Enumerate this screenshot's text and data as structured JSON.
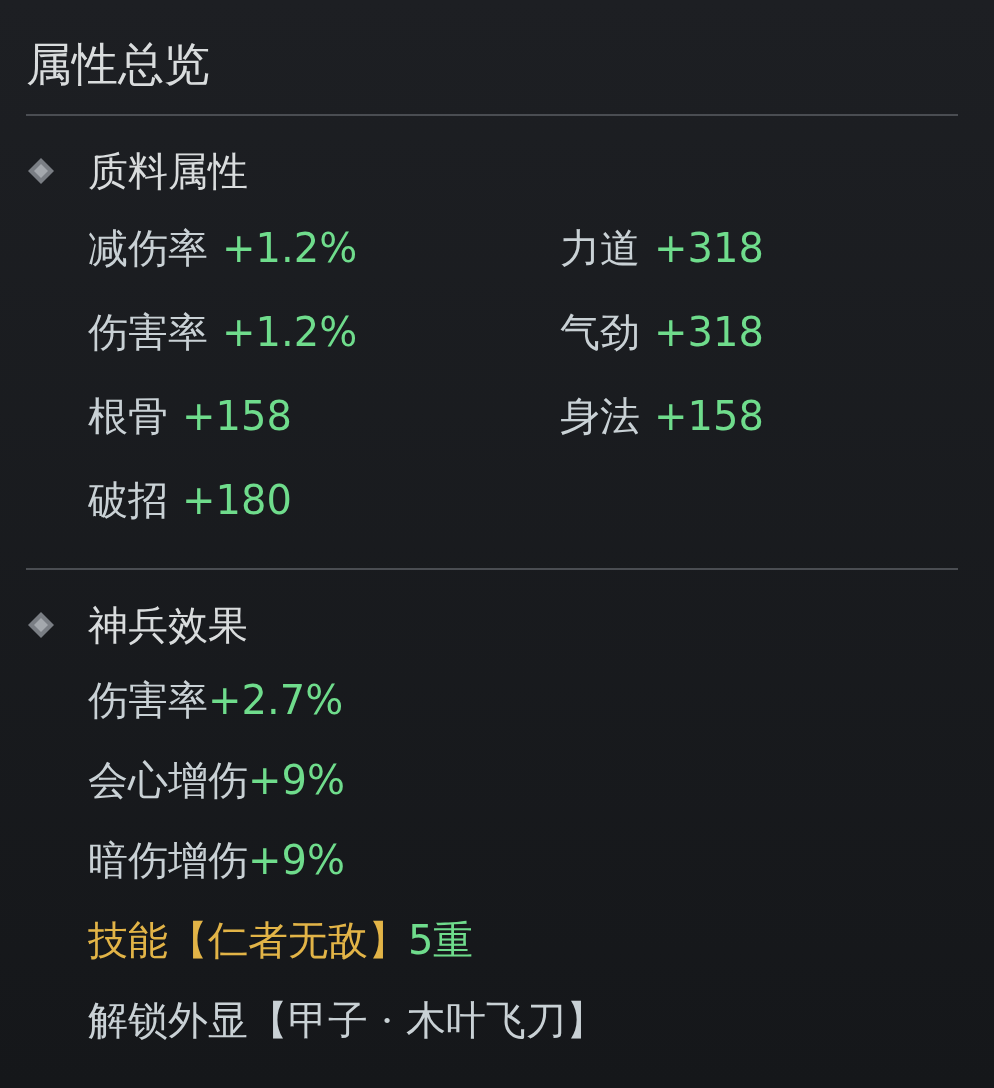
{
  "title": "属性总览",
  "sections": [
    {
      "kind": "grid",
      "header": "质料属性",
      "items": [
        {
          "kind": "stat",
          "label": "减伤率",
          "value": "+1.2%"
        },
        {
          "kind": "stat",
          "label": "力道",
          "value": "+318"
        },
        {
          "kind": "stat",
          "label": "伤害率",
          "value": "+1.2%"
        },
        {
          "kind": "stat",
          "label": "气劲",
          "value": "+318"
        },
        {
          "kind": "stat",
          "label": "根骨",
          "value": "+158"
        },
        {
          "kind": "stat",
          "label": "身法",
          "value": "+158"
        },
        {
          "kind": "stat",
          "label": "破招",
          "value": "+180"
        }
      ]
    },
    {
      "kind": "list",
      "header": "神兵效果",
      "items": [
        {
          "kind": "stat",
          "label": "伤害率",
          "value": "+2.7%"
        },
        {
          "kind": "stat",
          "label": "会心增伤",
          "value": "+9%"
        },
        {
          "kind": "stat",
          "label": "暗伤增伤",
          "value": "+9%"
        },
        {
          "kind": "skill",
          "label": "技能【仁者无敌】",
          "value": "5重"
        },
        {
          "kind": "unlock",
          "label": "解锁外显【甲子 · 木叶飞刀】"
        }
      ]
    }
  ]
}
